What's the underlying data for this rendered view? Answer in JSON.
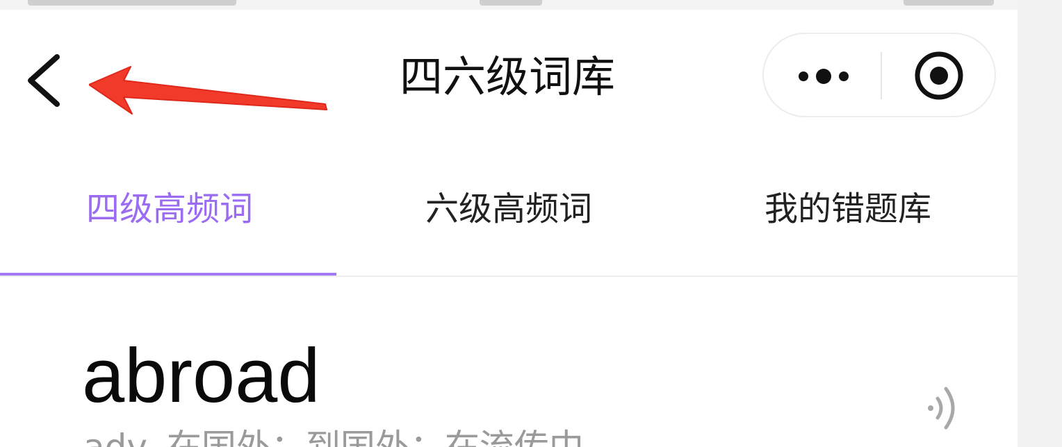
{
  "header": {
    "title": "四六级词库",
    "back_icon": "chevron-left-icon",
    "more_icon": "more-dots-icon",
    "close_icon": "target-close-icon"
  },
  "tabs": [
    {
      "label": "四级高频词",
      "active": true
    },
    {
      "label": "六级高频词",
      "active": false
    },
    {
      "label": "我的错题库",
      "active": false
    }
  ],
  "word_card": {
    "word": "abroad",
    "meaning": "adv. 在国外；到国外；在流传中",
    "audio_icon": "speaker-wave-icon"
  },
  "colors": {
    "accent": "#9b6cf1",
    "annotation_arrow": "#f23a2a"
  }
}
